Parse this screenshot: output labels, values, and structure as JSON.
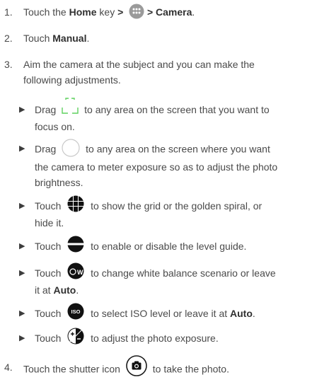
{
  "steps": {
    "s1": {
      "num": "1.",
      "a": "Touch the ",
      "b_home": "Home",
      "c": " key ",
      "gt1": ">",
      "gt2": " > Camera",
      "end": "."
    },
    "s2": {
      "num": "2.",
      "a": "Touch ",
      "b_manual": "Manual",
      "end": "."
    },
    "s3": {
      "num": "3.",
      "line1": "Aim the camera at the subject and you can make the",
      "line2": "following adjustments."
    },
    "s4": {
      "num": "4.",
      "a": "Touch the shutter icon",
      "b": "to take the photo."
    }
  },
  "bullets": {
    "b1": {
      "a": "Drag",
      "b": "to any area on the screen that you want to",
      "c": "focus on."
    },
    "b2": {
      "a": "Drag",
      "b": "to any area on the screen where you want",
      "c": "the camera to meter exposure so as to adjust the photo",
      "d": "brightness."
    },
    "b3": {
      "a": "Touch",
      "b": "to show the grid or the golden spiral, or",
      "c": "hide it."
    },
    "b4": {
      "a": "Touch",
      "b": "to enable or disable the level guide."
    },
    "b5": {
      "a": "Touch",
      "b": "to change white balance scenario or leave",
      "c": "it at ",
      "d_auto": "Auto",
      "e": "."
    },
    "b6": {
      "a": "Touch",
      "b": "to select ISO level or leave it at ",
      "c_auto": "Auto",
      "d": "."
    },
    "b7": {
      "a": "Touch",
      "b": "to adjust the photo exposure."
    }
  },
  "icons": {
    "apps": "apps-grid-icon",
    "focus": "focus-frame-icon",
    "meter": "metering-circle-icon",
    "grid": "grid-toggle-icon",
    "level": "level-guide-icon",
    "wb": "white-balance-icon",
    "wb_text": "W",
    "iso": "iso-icon",
    "iso_text": "ISO",
    "exposure": "exposure-icon",
    "shutter": "shutter-camera-icon"
  },
  "colors": {
    "text": "#4a4a4a",
    "focus_frame": "#5fd15f",
    "icon_dark": "#111111"
  }
}
